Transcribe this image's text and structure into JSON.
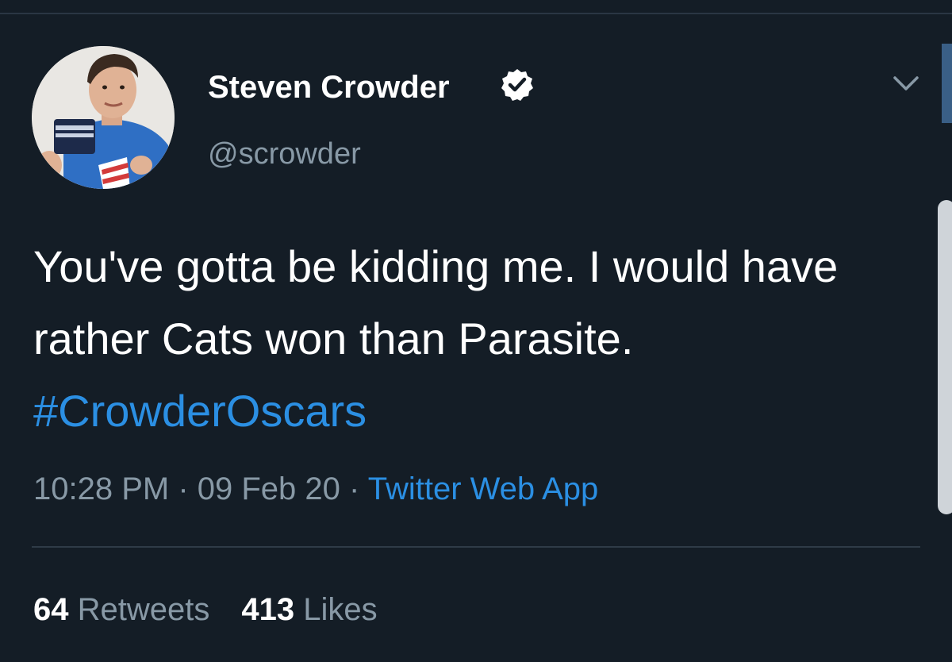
{
  "tweet": {
    "author": {
      "display_name": "Steven Crowder",
      "handle": "@scrowder",
      "verified": true,
      "verified_icon": "verified-badge-icon"
    },
    "menu_icon": "chevron-down-icon",
    "text": {
      "body": "You've gotta be kidding me. I would have rather Cats won than Parasite. ",
      "hashtag": "#CrowderOscars"
    },
    "meta": {
      "time": "10:28 PM",
      "separator_1": " · ",
      "date": "09 Feb 20",
      "separator_2": " · ",
      "source": "Twitter Web App"
    },
    "stats": {
      "retweets_count": "64",
      "retweets_label": "Retweets",
      "likes_count": "413",
      "likes_label": "Likes"
    }
  },
  "colors": {
    "background": "#141d26",
    "link": "#2b8fe3",
    "secondary_text": "#8899a6",
    "primary_text": "#ffffff"
  }
}
